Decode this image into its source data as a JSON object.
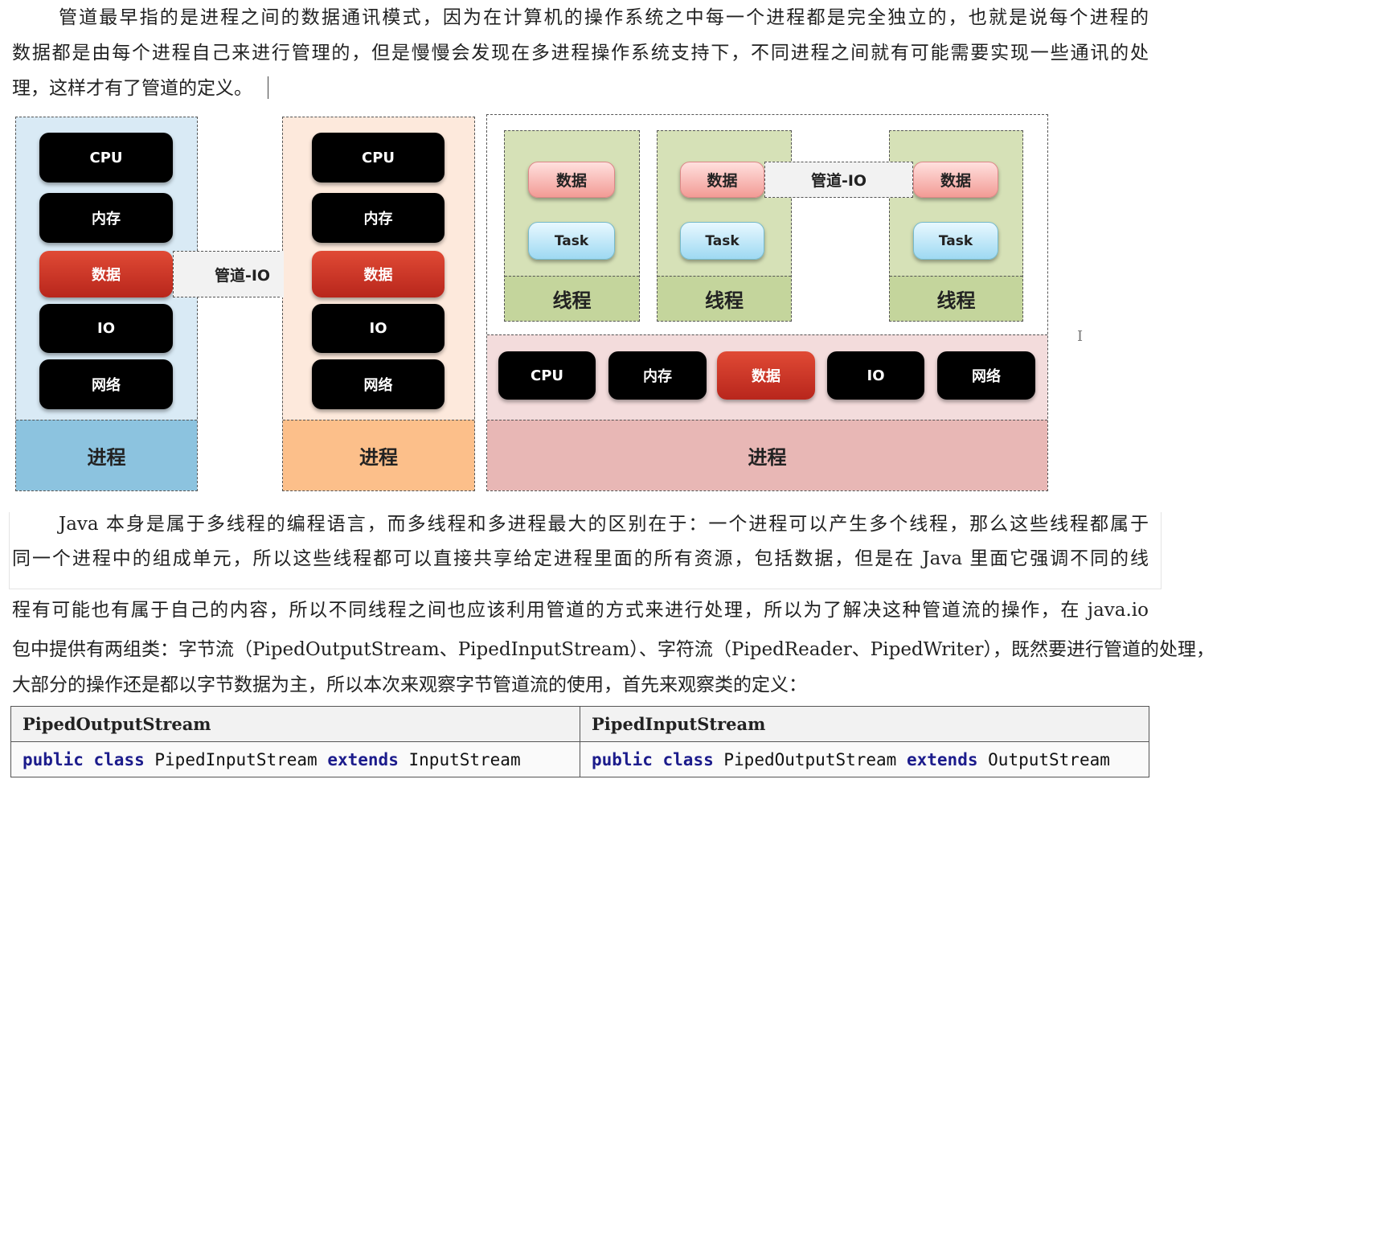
{
  "paragraph1": [
    "管道最早指的是进程之间的数据通讯模式，因为在计算机的操作系统之中每一个进程都是完全独立的，也就是说每个进程的",
    "数据都是由每个进程自己来进行管理的，但是慢慢会发现在多进程操作系统支持下，不同进程之间就有可能需要实现一些通讯的处",
    "理，这样才有了管道的定义。"
  ],
  "diagram": {
    "resources": [
      "CPU",
      "内存",
      "数据",
      "IO",
      "网络"
    ],
    "pipe_label": "管道-IO",
    "process_label": "进程",
    "thread_label": "线程",
    "thread_data": "数据",
    "thread_task": "Task"
  },
  "paragraph2": [
    "Java 本身是属于多线程的编程语言，而多线程和多进程最大的区别在于：一个进程可以产生多个线程，那么这些线程都属于",
    "同一个进程中的组成单元，所以这些线程都可以直接共享给定进程里面的所有资源，包括数据，但是在 Java 里面它强调不同的线",
    "程有可能也有属于自己的内容，所以不同线程之间也应该利用管道的方式来进行处理，所以为了解决这种管道流的操作，在 java.io",
    "包中提供有两组类：字节流（PipedOutputStream、PipedInputStream）、字符流（PipedReader、PipedWriter），既然要进行管道的处理，",
    "大部分的操作还是都以字节数据为主，所以本次来观察字节管道流的使用，首先来观察类的定义："
  ],
  "table": {
    "headers": [
      "PipedOutputStream",
      "PipedInputStream"
    ],
    "rows": [
      {
        "kw1": "public",
        "kw2": "class",
        "name": "PipedInputStream",
        "kw3": "extends",
        "parent": "InputStream"
      },
      {
        "kw1": "public",
        "kw2": "class",
        "name": "PipedOutputStream",
        "kw3": "extends",
        "parent": "OutputStream"
      }
    ]
  },
  "colors": {
    "blue_bg": "#d9eaf5",
    "blue_label": "#8cc3df",
    "orange_bg": "#fde9dc",
    "orange_label": "#fcbf8a",
    "pink_bg": "#f3dcdc",
    "pink_label": "#e8b7b5",
    "green_bg": "#d6e1b7",
    "green_label": "#c4d59c"
  }
}
